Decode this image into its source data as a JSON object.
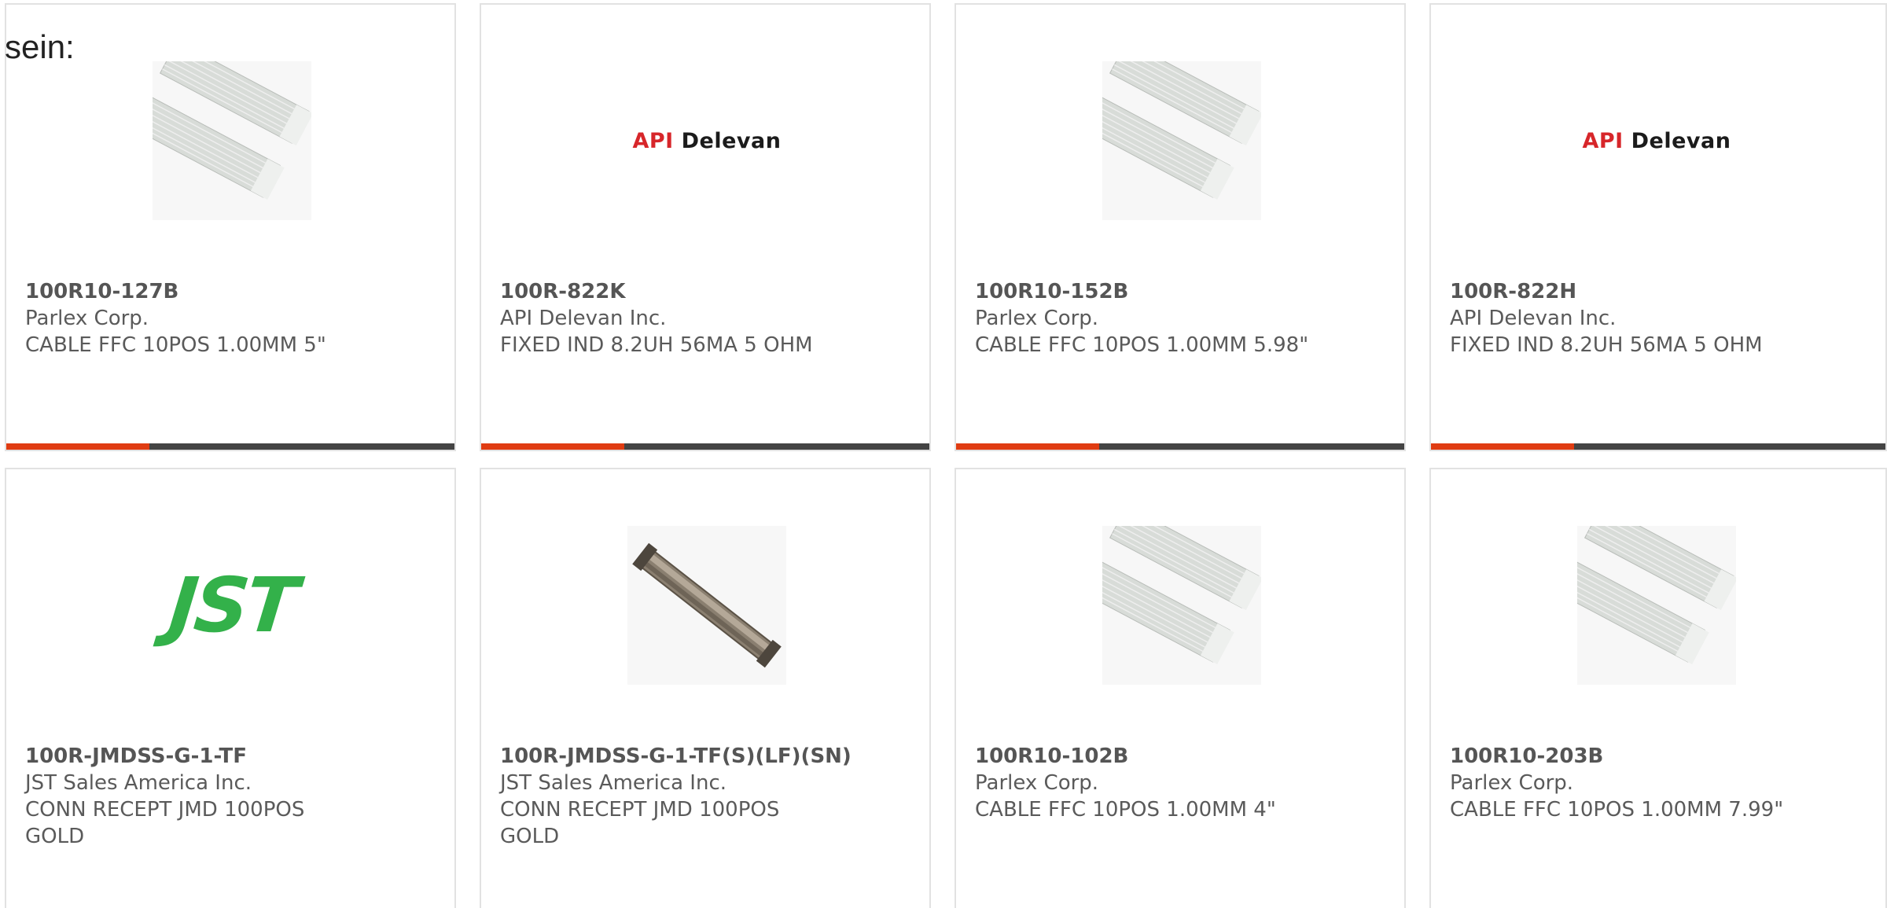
{
  "intro": {
    "text": "sein:"
  },
  "colors": {
    "accent": "#e03c12",
    "bar": "#444444",
    "api_red": "#d7262a",
    "jst_green": "#33b14a"
  },
  "products": [
    {
      "part_number": "100R10-127B",
      "manufacturer": "Parlex Corp.",
      "description": "CABLE FFC 10POS 1.00MM 5\"",
      "image": "flat-ribbon-cable",
      "show_bar": true
    },
    {
      "part_number": "100R-822K",
      "manufacturer": "API Delevan Inc.",
      "description": "FIXED IND 8.2UH 56MA 5 OHM",
      "image": "api-delevan-logo",
      "logo_text": {
        "red": "API",
        "black": "Delevan"
      },
      "show_bar": true
    },
    {
      "part_number": "100R10-152B",
      "manufacturer": "Parlex Corp.",
      "description": "CABLE FFC 10POS 1.00MM 5.98\"",
      "image": "flat-ribbon-cable",
      "show_bar": true
    },
    {
      "part_number": "100R-822H",
      "manufacturer": "API Delevan Inc.",
      "description": "FIXED IND 8.2UH 56MA 5 OHM",
      "image": "api-delevan-logo",
      "logo_text": {
        "red": "API",
        "black": "Delevan"
      },
      "show_bar": true
    },
    {
      "part_number": "100R-JMDSS-G-1-TF",
      "manufacturer": "JST Sales America Inc.",
      "description": "CONN RECEPT JMD 100POS GOLD",
      "image": "jst-logo",
      "logo_text": {
        "text": "JST"
      },
      "show_bar": false
    },
    {
      "part_number": "100R-JMDSS-G-1-TF(S)(LF)(SN)",
      "manufacturer": "JST Sales America Inc.",
      "description": "CONN RECEPT JMD 100POS GOLD",
      "image": "connector-photo",
      "show_bar": false
    },
    {
      "part_number": "100R10-102B",
      "manufacturer": "Parlex Corp.",
      "description": "CABLE FFC 10POS 1.00MM 4\"",
      "image": "flat-ribbon-cable",
      "show_bar": false
    },
    {
      "part_number": "100R10-203B",
      "manufacturer": "Parlex Corp.",
      "description": "CABLE FFC 10POS 1.00MM 7.99\"",
      "image": "flat-ribbon-cable",
      "show_bar": false
    }
  ]
}
